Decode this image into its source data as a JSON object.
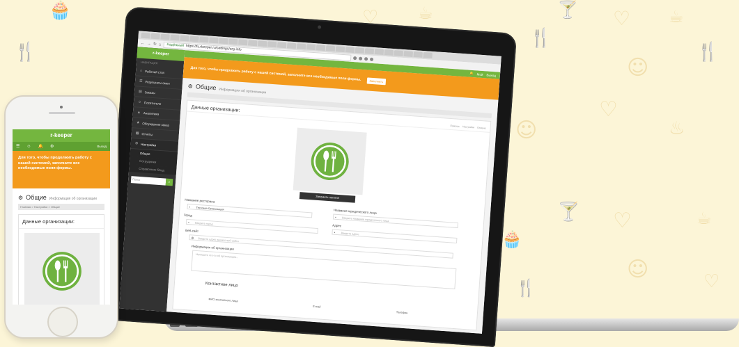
{
  "colors": {
    "green": "#74b63f",
    "orange": "#f39a1c",
    "sidebar": "#323232",
    "background": "#fcf5d7"
  },
  "laptop": {
    "browser": {
      "url_secure": "Надёжный",
      "url": "https://fs.rkeeper.ru/settings/org-info"
    },
    "app": {
      "logo": "r-keeper",
      "section_label": "НАВИГАЦИЯ",
      "sidebar_items": [
        {
          "icon": "home-icon",
          "label": "Рабочий стол"
        },
        {
          "icon": "list-icon",
          "label": "Результаты смен"
        },
        {
          "icon": "receipt-icon",
          "label": "Заказы"
        },
        {
          "icon": "users-icon",
          "label": "Посетители"
        },
        {
          "icon": "chart-icon",
          "label": "Аналитика"
        },
        {
          "icon": "star-icon",
          "label": "Обсуждения заказ"
        },
        {
          "icon": "doc-icon",
          "label": "Отчеты"
        },
        {
          "icon": "gear-icon",
          "label": "Настройки"
        }
      ],
      "sidebar_sub": [
        "Общие",
        "Сотрудники",
        "Справочник блюд"
      ],
      "search_placeholder": "Поиск",
      "topbar": {
        "user": "Мой",
        "logout": "Выход"
      },
      "warning": "Для того, чтобы продолжить работу с нашей системой, заполните все необходимые поля формы.",
      "warning_button": "Заполнить",
      "page_title": "Общие",
      "page_subtitle": "Информация об организации",
      "card_title": "Данные организации:",
      "card_tools": [
        "Помощь",
        "Настройки",
        "Отмена"
      ],
      "logo_button": "Загрузить логотип",
      "fields": {
        "restaurant_name_label": "Название ресторана",
        "restaurant_name_value": "Тестовая Организация",
        "legal_name_label": "Название юридического лица",
        "legal_name_placeholder": "Введите название юридического лица",
        "city_label": "Город",
        "city_placeholder": "Введите город",
        "address_label": "Адрес",
        "address_placeholder": "Введите адрес",
        "website_label": "Веб-сайт",
        "website_placeholder": "Введите адрес вашего веб-сайта",
        "info_label": "Информация об организации",
        "info_placeholder": "Напишите что-то об организации..."
      },
      "contacts_title": "Контактное лицо",
      "contacts_columns": [
        "ФИО контактного лица",
        "E-mail",
        "Телефон"
      ]
    }
  },
  "phone": {
    "logo": "r-keeper",
    "logout": "Выход",
    "warning": "Для того, чтобы продолжить работу с нашей системой, заполните все необходимые поля формы.",
    "page_title": "Общие",
    "page_subtitle": "Информация об организации",
    "breadcrumb": "Главная > Настройки > Общие",
    "card_title": "Данные организации:"
  }
}
